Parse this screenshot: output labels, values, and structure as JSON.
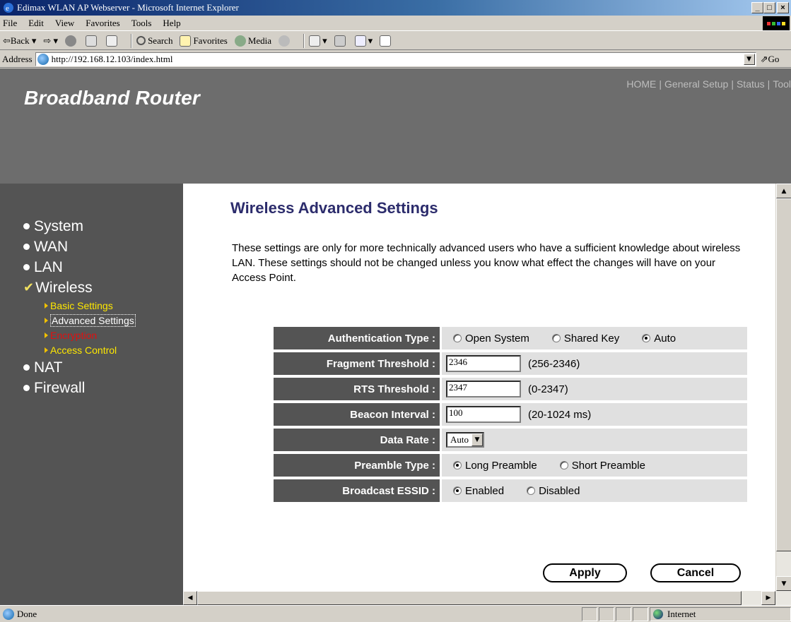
{
  "window": {
    "title": "Edimax WLAN AP Webserver - Microsoft Internet Explorer",
    "min": "_",
    "max": "□",
    "close": "×"
  },
  "menu": {
    "items": [
      {
        "label": "File"
      },
      {
        "label": "Edit"
      },
      {
        "label": "View"
      },
      {
        "label": "Favorites"
      },
      {
        "label": "Tools"
      },
      {
        "label": "Help"
      }
    ]
  },
  "toolbar": {
    "back": "⇦Back",
    "forward": "⇨",
    "search": "Search",
    "favorites": "Favorites",
    "media": "Media"
  },
  "address": {
    "label": "Address",
    "url": "http://192.168.12.103/index.html",
    "go": "Go"
  },
  "header": {
    "brand": "Broadband Router",
    "nav": [
      "HOME",
      "General Setup",
      "Status",
      "Tool"
    ]
  },
  "sidebar": {
    "items": [
      {
        "label": "System"
      },
      {
        "label": "WAN"
      },
      {
        "label": "LAN"
      },
      {
        "label": "Wireless"
      },
      {
        "label": "NAT"
      },
      {
        "label": "Firewall"
      }
    ],
    "wireless_sub": [
      {
        "label": "Basic Settings"
      },
      {
        "label": "Advanced Settings"
      },
      {
        "label": "Encryption"
      },
      {
        "label": "Access Control"
      }
    ]
  },
  "page": {
    "title": "Wireless Advanced Settings",
    "intro": "These settings are only for more technically advanced users who have a sufficient knowledge about wireless LAN. These settings should not be changed unless you know what effect the changes will have on your Access Point."
  },
  "settings": {
    "auth": {
      "label": "Authentication Type :",
      "options": [
        "Open System",
        "Shared Key",
        "Auto"
      ],
      "selected": "Auto"
    },
    "fragment": {
      "label": "Fragment Threshold :",
      "value": "2346",
      "range": "(256-2346)"
    },
    "rts": {
      "label": "RTS Threshold :",
      "value": "2347",
      "range": "(0-2347)"
    },
    "beacon": {
      "label": "Beacon Interval :",
      "value": "100",
      "range": "(20-1024 ms)"
    },
    "data_rate": {
      "label": "Data Rate :",
      "value": "Auto"
    },
    "preamble": {
      "label": "Preamble Type :",
      "options": [
        "Long Preamble",
        "Short Preamble"
      ],
      "selected": "Long Preamble"
    },
    "essid": {
      "label": "Broadcast ESSID :",
      "options": [
        "Enabled",
        "Disabled"
      ],
      "selected": "Enabled"
    }
  },
  "buttons": {
    "apply": "Apply",
    "cancel": "Cancel"
  },
  "status": {
    "text": "Done",
    "zone": "Internet"
  },
  "colors": {
    "header_bg": "#6d6d6d",
    "sidebar_bg": "#545454",
    "title_color": "#2c2c6c",
    "label_bg": "#545454",
    "value_bg": "#e0e0e0",
    "sub_yellow": "#ffe800",
    "sub_red": "#e01010"
  }
}
